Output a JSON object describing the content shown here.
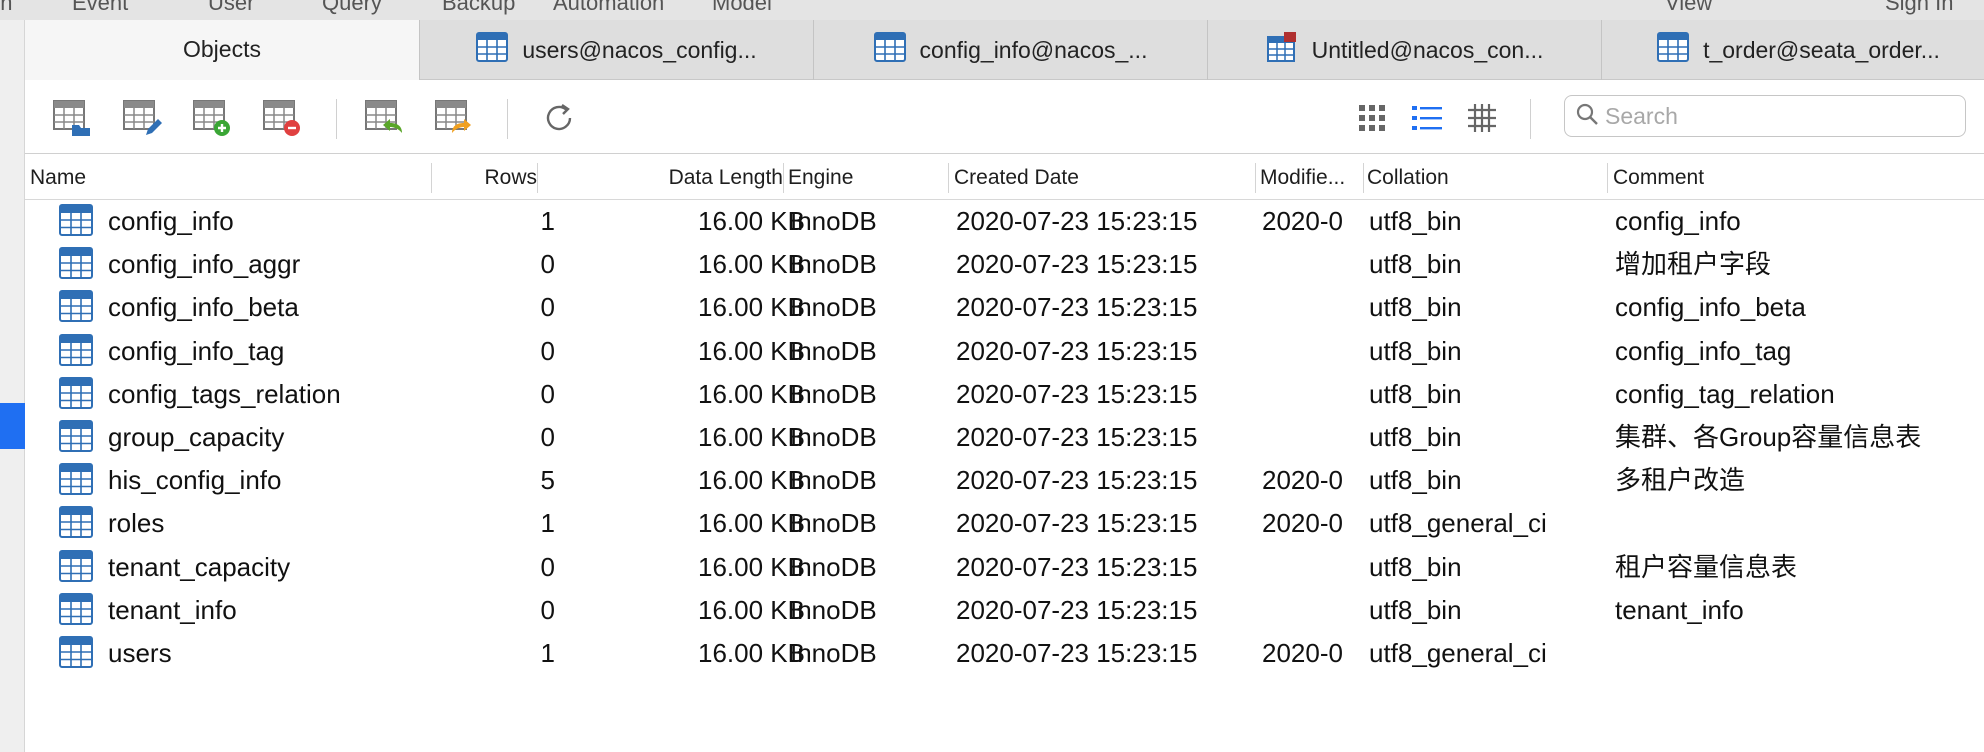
{
  "menubar": {
    "items": [
      "Event",
      "User",
      "Query",
      "Backup",
      "Automation",
      "Model",
      "View",
      "Sign In"
    ]
  },
  "tabs": [
    {
      "label": "Objects",
      "icon": "none",
      "active": true
    },
    {
      "label": "users@nacos_config...",
      "icon": "table-icon",
      "active": false
    },
    {
      "label": "config_info@nacos_...",
      "icon": "table-icon",
      "active": false
    },
    {
      "label": "Untitled@nacos_con...",
      "icon": "query-icon",
      "active": false
    },
    {
      "label": "t_order@seata_order...",
      "icon": "table-icon",
      "active": false
    }
  ],
  "toolbar": {
    "buttons": [
      "open-table",
      "design-table",
      "new-table",
      "delete-table",
      "import-wizard",
      "export-wizard",
      "refresh"
    ],
    "view_modes": [
      "grid-view",
      "list-view",
      "detail-view"
    ],
    "active_view": "list-view",
    "search_placeholder": "Search"
  },
  "columns": {
    "name": "Name",
    "rows": "Rows",
    "data_length": "Data Length",
    "engine": "Engine",
    "created": "Created Date",
    "modified": "Modifie...",
    "collation": "Collation",
    "comment": "Comment"
  },
  "rows": [
    {
      "name": "config_info",
      "rows": "1",
      "data_length": "16.00 KB",
      "engine": "InnoDB",
      "created": "2020-07-23 15:23:15",
      "modified": "2020-0",
      "collation": "utf8_bin",
      "comment": "config_info"
    },
    {
      "name": "config_info_aggr",
      "rows": "0",
      "data_length": "16.00 KB",
      "engine": "InnoDB",
      "created": "2020-07-23 15:23:15",
      "modified": "",
      "collation": "utf8_bin",
      "comment": "增加租户字段"
    },
    {
      "name": "config_info_beta",
      "rows": "0",
      "data_length": "16.00 KB",
      "engine": "InnoDB",
      "created": "2020-07-23 15:23:15",
      "modified": "",
      "collation": "utf8_bin",
      "comment": "config_info_beta"
    },
    {
      "name": "config_info_tag",
      "rows": "0",
      "data_length": "16.00 KB",
      "engine": "InnoDB",
      "created": "2020-07-23 15:23:15",
      "modified": "",
      "collation": "utf8_bin",
      "comment": "config_info_tag"
    },
    {
      "name": "config_tags_relation",
      "rows": "0",
      "data_length": "16.00 KB",
      "engine": "InnoDB",
      "created": "2020-07-23 15:23:15",
      "modified": "",
      "collation": "utf8_bin",
      "comment": "config_tag_relation"
    },
    {
      "name": "group_capacity",
      "rows": "0",
      "data_length": "16.00 KB",
      "engine": "InnoDB",
      "created": "2020-07-23 15:23:15",
      "modified": "",
      "collation": "utf8_bin",
      "comment": "集群、各Group容量信息表"
    },
    {
      "name": "his_config_info",
      "rows": "5",
      "data_length": "16.00 KB",
      "engine": "InnoDB",
      "created": "2020-07-23 15:23:15",
      "modified": "2020-0",
      "collation": "utf8_bin",
      "comment": "多租户改造"
    },
    {
      "name": "roles",
      "rows": "1",
      "data_length": "16.00 KB",
      "engine": "InnoDB",
      "created": "2020-07-23 15:23:15",
      "modified": "2020-0",
      "collation": "utf8_general_ci",
      "comment": ""
    },
    {
      "name": "tenant_capacity",
      "rows": "0",
      "data_length": "16.00 KB",
      "engine": "InnoDB",
      "created": "2020-07-23 15:23:15",
      "modified": "",
      "collation": "utf8_bin",
      "comment": "租户容量信息表"
    },
    {
      "name": "tenant_info",
      "rows": "0",
      "data_length": "16.00 KB",
      "engine": "InnoDB",
      "created": "2020-07-23 15:23:15",
      "modified": "",
      "collation": "utf8_bin",
      "comment": "tenant_info"
    },
    {
      "name": "users",
      "rows": "1",
      "data_length": "16.00 KB",
      "engine": "InnoDB",
      "created": "2020-07-23 15:23:15",
      "modified": "2020-0",
      "collation": "utf8_general_ci",
      "comment": ""
    }
  ],
  "colors": {
    "accent": "#1f6ff2",
    "table_icon": "#2f6fb5",
    "add": "#3aa635",
    "remove": "#e04040",
    "import": "#5aa62a",
    "export": "#f0a020"
  }
}
